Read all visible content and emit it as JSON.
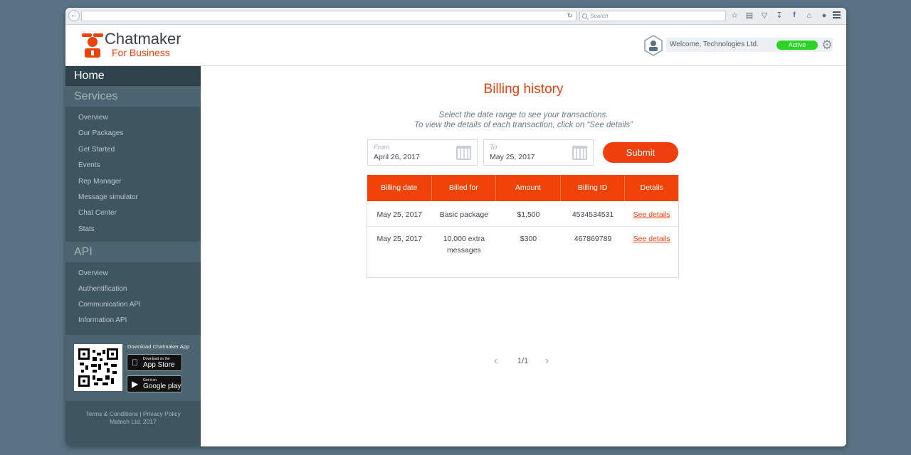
{
  "browser": {
    "search_placeholder": "Search"
  },
  "header": {
    "logo_name": "Chatmaker",
    "logo_sub": "For Business",
    "welcome": "Welcome, Technologies Ltd.",
    "status": "Active",
    "accent": "#e8420f"
  },
  "sidebar": {
    "home": "Home",
    "services_title": "Services",
    "services": [
      "Overview",
      "Our Packages",
      "Get Started",
      "Events",
      "Rep Manager",
      "Message simulator",
      "Chat Center",
      "Stats"
    ],
    "api_title": "API",
    "api": [
      "Overview",
      "Authentification",
      "Communication API",
      "Information API"
    ],
    "download_title": "Download Chatmaker App",
    "appstore_small": "Download on the",
    "appstore_big": "App Store",
    "googleplay_small": "Get it on",
    "googleplay_big": "Google play",
    "terms": "Terms & Conditions",
    "separator": "|",
    "privacy": "Privacy Policy",
    "copyright": "Matech Ltd. 2017"
  },
  "main": {
    "title": "Billing history",
    "instruction_1": "Select the date range to see your transactions.",
    "instruction_2": "To view the details of each transaction, click on “See details”",
    "from_label": "From",
    "from_value": "April 26, 2017",
    "to_label": "To",
    "to_value": "May 25, 2017",
    "submit": "Submit",
    "columns": [
      "Billing date",
      "Billed for",
      "Amount",
      "Billing ID",
      "Details"
    ],
    "rows": [
      {
        "date": "May 25, 2017",
        "billed_for": "Basic package",
        "amount": "$1,500",
        "id": "4534534531",
        "details": "See details"
      },
      {
        "date": "May 25, 2017",
        "billed_for": "10,000 extra messages",
        "amount": "$300",
        "id": "467869789",
        "details": "See details"
      }
    ],
    "page_indicator": "1/1"
  }
}
